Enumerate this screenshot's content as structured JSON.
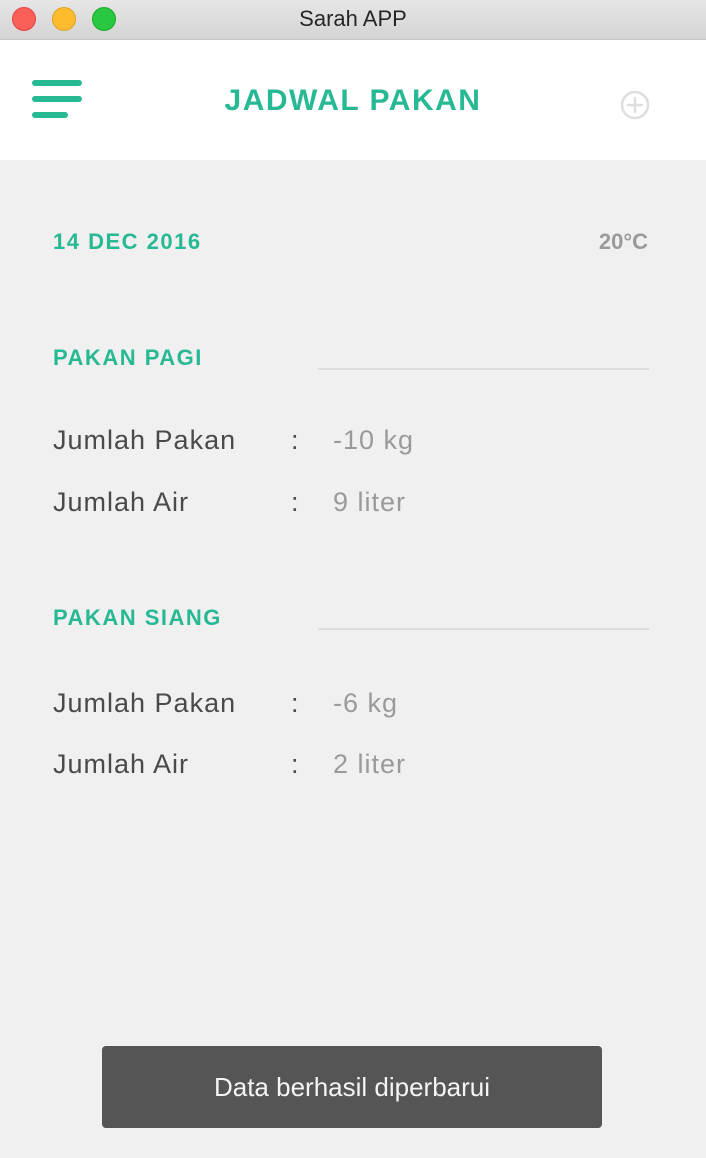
{
  "window": {
    "title": "Sarah APP"
  },
  "header": {
    "title": "JADWAL PAKAN",
    "menu_icon": "menu-icon",
    "add_icon": "plus-circle-icon"
  },
  "info": {
    "date": "14 DEC 2016",
    "temperature": "20°C"
  },
  "sections": [
    {
      "title": "PAKAN PAGI",
      "rows": [
        {
          "label": "Jumlah Pakan",
          "separator": ":",
          "value": "-10 kg"
        },
        {
          "label": "Jumlah Air",
          "separator": ":",
          "value": "9 liter"
        }
      ]
    },
    {
      "title": "PAKAN SIANG",
      "rows": [
        {
          "label": "Jumlah Pakan",
          "separator": ":",
          "value": "-6 kg"
        },
        {
          "label": "Jumlah Air",
          "separator": ":",
          "value": "2 liter"
        }
      ]
    }
  ],
  "toast": {
    "message": "Data berhasil diperbarui"
  },
  "colors": {
    "accent": "#27b994",
    "muted": "#9a9a9a",
    "text": "#4a4a4a",
    "toast_bg": "#555555"
  }
}
